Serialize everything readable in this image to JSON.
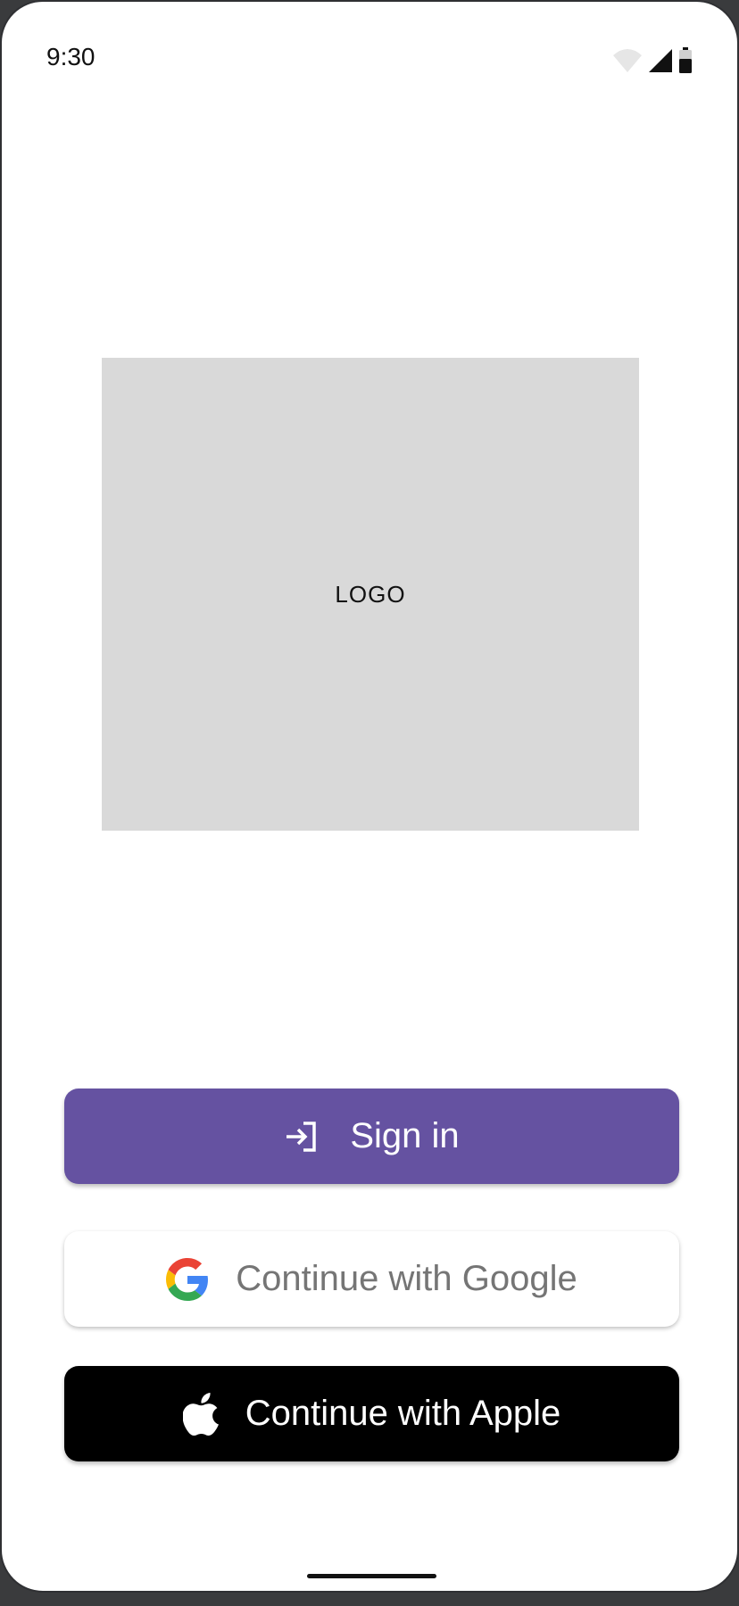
{
  "status_bar": {
    "time": "9:30",
    "icons": [
      "wifi-icon",
      "cellular-signal-icon",
      "battery-icon"
    ]
  },
  "logo": {
    "label": "LOGO"
  },
  "buttons": {
    "sign_in": {
      "label": "Sign in",
      "icon": "login-arrow-icon",
      "color": "#6552a1"
    },
    "google": {
      "label": "Continue with Google",
      "icon": "google-g-icon"
    },
    "apple": {
      "label": "Continue with Apple",
      "icon": "apple-icon"
    }
  },
  "colors": {
    "accent": "#6552a1",
    "logo_placeholder": "#d9d9d9",
    "apple_button": "#000000"
  }
}
